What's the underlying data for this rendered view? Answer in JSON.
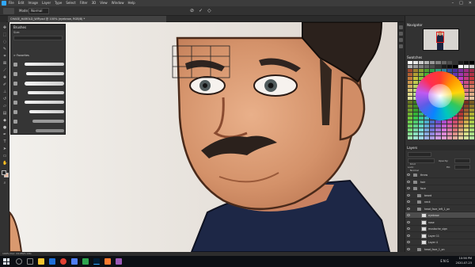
{
  "menubar": {
    "items": [
      "File",
      "Edit",
      "Image",
      "Layer",
      "Type",
      "Select",
      "Filter",
      "3D",
      "View",
      "Window",
      "Help"
    ],
    "window_controls": [
      "–",
      "□",
      "✕"
    ]
  },
  "options": {
    "mode_label": "Mode:",
    "mode_value": "Normal",
    "cancel_icon": "⊘",
    "commit_icon": "✓",
    "settings_icon": "◇"
  },
  "document": {
    "tab_title": "CHASE_HAROLD_WIP.psd @ 100% (eyebrow, RGB/8) *"
  },
  "brushes": {
    "title": "Brushes",
    "size_label": "Size:",
    "folder_label": "> Favorites"
  },
  "panels": {
    "navigator_title": "Navigator",
    "swatches_title": "Swatches",
    "layers_title": "Layers",
    "kind_label": "Kind",
    "blend_label": "Normal",
    "opacity_label": "Opacity:",
    "lock_label": "Lock:",
    "fill_label": "Fill:"
  },
  "layers": [
    {
      "name": "throw",
      "type": "folder",
      "indent": 0,
      "selected": false
    },
    {
      "name": "hair",
      "type": "folder",
      "indent": 0,
      "selected": false
    },
    {
      "name": "face",
      "type": "folder",
      "indent": 0,
      "selected": false
    },
    {
      "name": "beard",
      "type": "folder",
      "indent": 1,
      "selected": false
    },
    {
      "name": "neck",
      "type": "folder",
      "indent": 1,
      "selected": false
    },
    {
      "name": "head_face_left_1_on",
      "type": "folder",
      "indent": 1,
      "selected": false
    },
    {
      "name": "eyebrow",
      "type": "layer",
      "indent": 2,
      "selected": true
    },
    {
      "name": "nose",
      "type": "layer",
      "indent": 2,
      "selected": false
    },
    {
      "name": "mustache_sign",
      "type": "layer",
      "indent": 2,
      "selected": false
    },
    {
      "name": "Layer 11",
      "type": "layer",
      "indent": 2,
      "selected": false
    },
    {
      "name": "Layer 4",
      "type": "layer",
      "indent": 2,
      "selected": false
    },
    {
      "name": "head_face_1_on",
      "type": "folder",
      "indent": 1,
      "selected": false
    }
  ],
  "status": {
    "text": "100%     Doc: 24.0M/1.14G"
  },
  "taskbar": {
    "time": "10:56 PM",
    "date": "2020-07-23",
    "lang": "ENG"
  },
  "colors": {
    "accent": "#31a8ff",
    "skin": "#d9996f",
    "background_swatch": "#e8b89c"
  },
  "icons": {
    "tools": [
      "move-icon",
      "marquee-icon",
      "lasso-icon",
      "quick-select-icon",
      "crop-icon",
      "frame-icon",
      "eyedropper-icon",
      "healing-icon",
      "brush-icon",
      "stamp-icon",
      "history-brush-icon",
      "eraser-icon",
      "gradient-icon",
      "blur-icon",
      "dodge-icon",
      "pen-icon",
      "type-icon",
      "path-select-icon",
      "shape-icon",
      "hand-icon",
      "zoom-icon"
    ]
  }
}
